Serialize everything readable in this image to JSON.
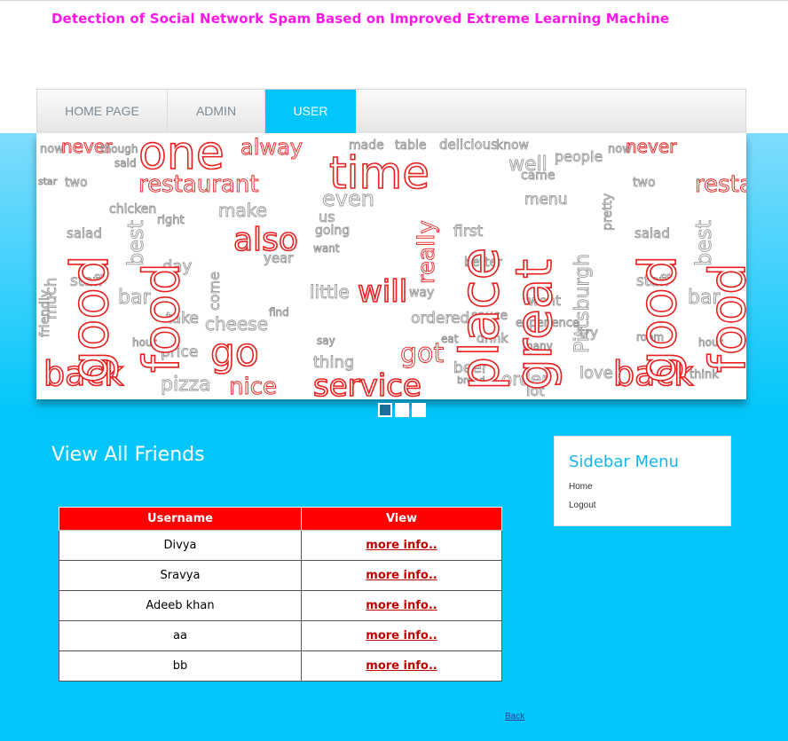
{
  "site": {
    "title": "Detection of Social Network Spam Based on Improved Extreme Learning Machine"
  },
  "nav": {
    "items": [
      {
        "label": "HOME PAGE",
        "active": false
      },
      {
        "label": "ADMIN",
        "active": false
      },
      {
        "label": "USER",
        "active": true
      }
    ]
  },
  "banner": {
    "description": "word cloud slideshow image",
    "slide_count": 3,
    "active_slide": 1,
    "colors": {
      "red": "#e82020",
      "gray": "#9a9a9a"
    }
  },
  "main": {
    "heading": "View All Friends",
    "table": {
      "headers": [
        "Username",
        "View"
      ],
      "rows": [
        {
          "username": "Divya",
          "view": "more info.."
        },
        {
          "username": "Sravya",
          "view": "more info.."
        },
        {
          "username": "Adeeb khan",
          "view": "more info.."
        },
        {
          "username": "aa",
          "view": "more info.."
        },
        {
          "username": "bb",
          "view": "more info.."
        }
      ]
    },
    "back_label": "Back"
  },
  "sidebar": {
    "title": "Sidebar Menu",
    "items": [
      {
        "label": "Home"
      },
      {
        "label": "Logout"
      }
    ]
  },
  "colors": {
    "background": "#00c6fb",
    "title": "#ff17e8",
    "table_header": "#ff0000",
    "link": "#c00000"
  }
}
